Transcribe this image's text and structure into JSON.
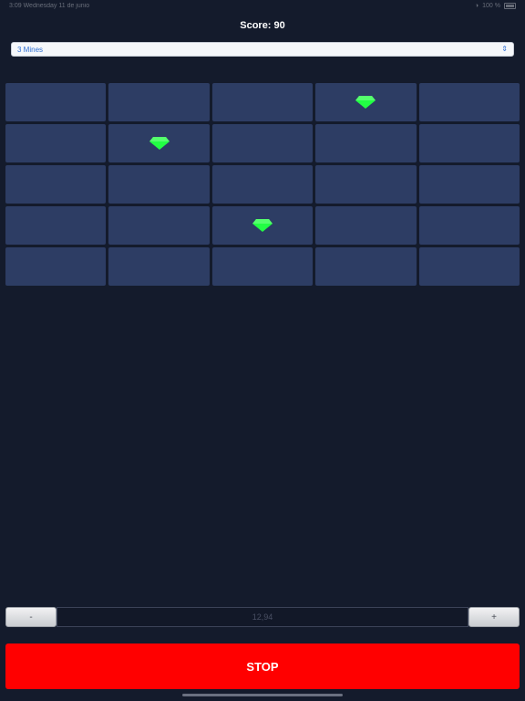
{
  "status_bar": {
    "left_text": "3:09 Wednesday 11 de junio",
    "right_text": "100 %"
  },
  "score": {
    "label": "Score: 90"
  },
  "mines_select": {
    "value": "3 Mines"
  },
  "board": {
    "rows": 5,
    "cols": 5,
    "gems": [
      [
        0,
        3
      ],
      [
        1,
        1
      ],
      [
        3,
        2
      ]
    ],
    "gem_color": "#22ff44",
    "tile_color": "#2d3d64"
  },
  "bet": {
    "minus_label": "-",
    "amount": "12,94",
    "plus_label": "+"
  },
  "actions": {
    "stop_label": "STOP",
    "stop_color": "#ff0000"
  }
}
